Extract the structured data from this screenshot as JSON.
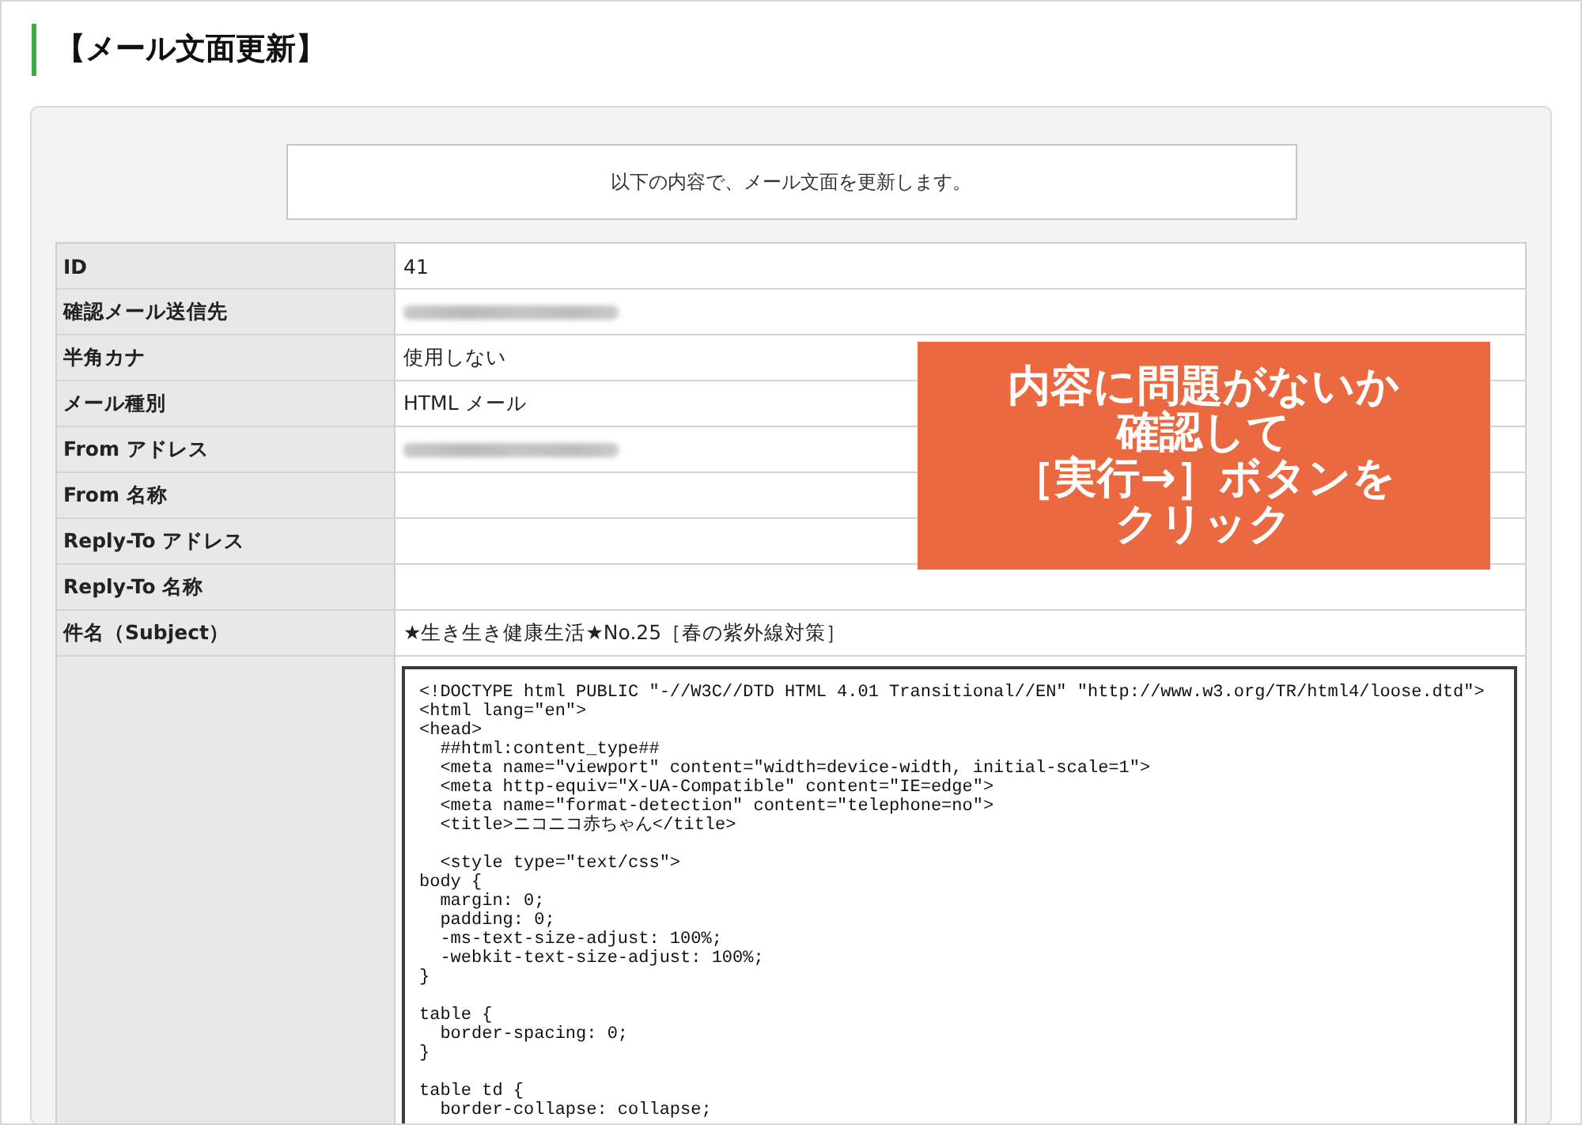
{
  "page_title": "【メール文面更新】",
  "notice": "以下の内容で、メール文面を更新します。",
  "fields": [
    {
      "label": "ID",
      "value": "41",
      "redacted": false
    },
    {
      "label": "確認メール送信先",
      "redacted": true
    },
    {
      "label": "半角カナ",
      "value": "使用しない",
      "redacted": false
    },
    {
      "label": "メール種別",
      "value": "HTML メール",
      "redacted": false
    },
    {
      "label": "From アドレス",
      "redacted": true
    },
    {
      "label": "From 名称",
      "redacted": false
    },
    {
      "label": "Reply-To アドレス",
      "redacted": false
    },
    {
      "label": "Reply-To 名称",
      "redacted": false
    },
    {
      "label": "件名（Subject）",
      "value": "★生き生き健康生活★No.25［春の紫外線対策］",
      "redacted": false
    }
  ],
  "body_source": {
    "value": "<!DOCTYPE html PUBLIC \"-//W3C//DTD HTML 4.01 Transitional//EN\" \"http://www.w3.org/TR/html4/loose.dtd\">\n<html lang=\"en\">\n<head>\n  ##html:content_type##\n  <meta name=\"viewport\" content=\"width=device-width, initial-scale=1\">\n  <meta http-equiv=\"X-UA-Compatible\" content=\"IE=edge\">\n  <meta name=\"format-detection\" content=\"telephone=no\">\n  <title>ニコニコ赤ちゃん</title>\n\n  <style type=\"text/css\">\nbody {\n  margin: 0;\n  padding: 0;\n  -ms-text-size-adjust: 100%;\n  -webkit-text-size-adjust: 100%;\n}\n\ntable {\n  border-spacing: 0;\n}\n\ntable td {\n  border-collapse: collapse;"
  },
  "callout": {
    "lines": [
      "内容に問題がないか",
      "確認して",
      "［実行→］ボタンを",
      "クリック"
    ]
  }
}
